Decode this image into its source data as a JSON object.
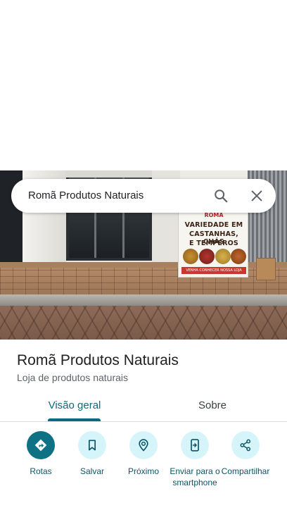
{
  "search": {
    "query": "Romã Produtos Naturais"
  },
  "place": {
    "name": "Romã Produtos Naturais",
    "category": "Loja de produtos naturais",
    "photo_sign": {
      "brand": "ROMÃ",
      "line1": "VARIEDADE EM",
      "line2": "CASTANHAS, CHÁS",
      "line3": "E TEMPEROS",
      "footer": "VENHA CONHECER NOSSA LOJA"
    }
  },
  "tabs": [
    {
      "label": "Visão geral",
      "selected": true
    },
    {
      "label": "Sobre",
      "selected": false
    }
  ],
  "actions": [
    {
      "label": "Rotas",
      "icon": "directions-icon"
    },
    {
      "label": "Salvar",
      "icon": "bookmark-icon"
    },
    {
      "label": "Próximo",
      "icon": "nearby-icon"
    },
    {
      "label": "Enviar para o smartphone",
      "icon": "send-to-phone-icon"
    },
    {
      "label": "Compartilhar",
      "icon": "share-icon"
    }
  ],
  "colors": {
    "accent": "#0b6a7d",
    "primary_button": "#0e7184",
    "button_bg": "#d5f5fb"
  }
}
